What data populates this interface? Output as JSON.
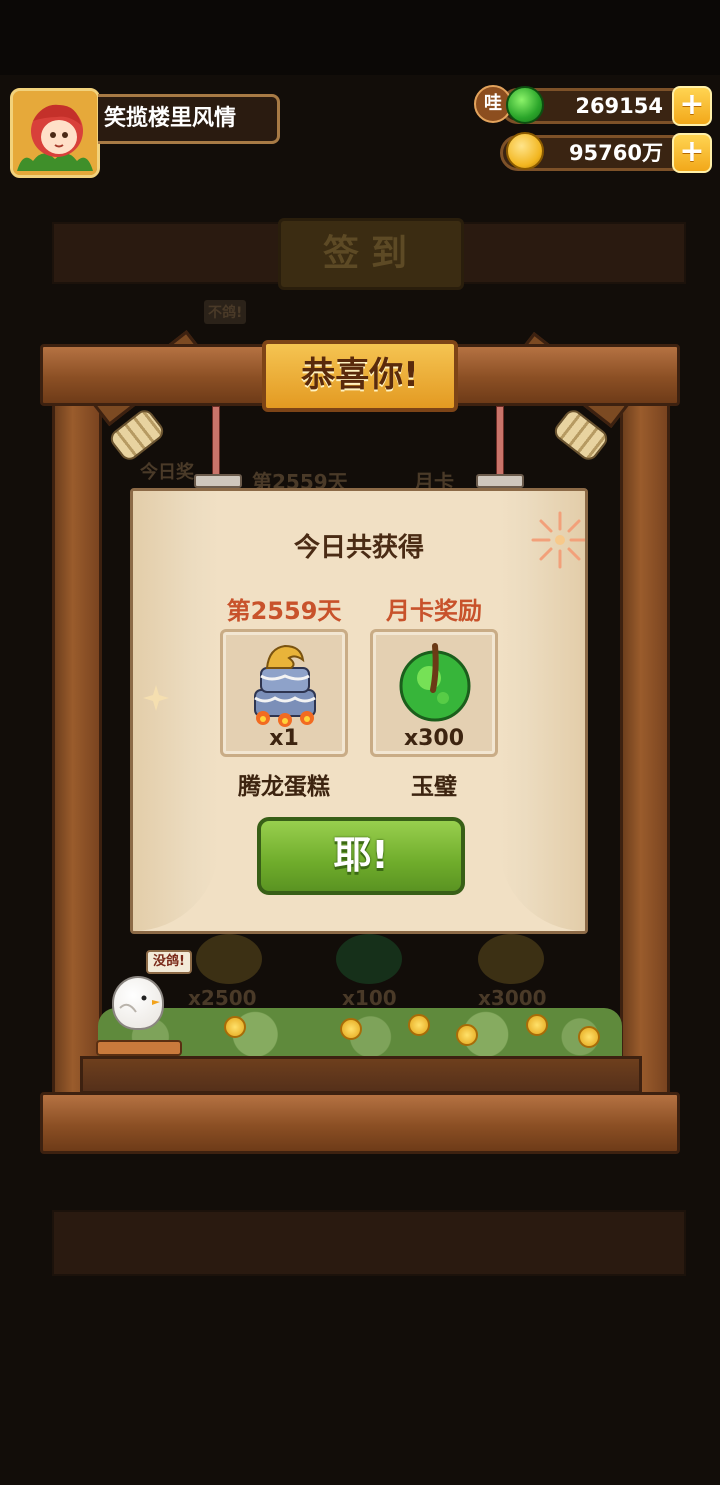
{
  "player": {
    "name": "笑揽楼里风情"
  },
  "currencies": {
    "jade": {
      "badge": "哇",
      "value": "269154",
      "add": "+"
    },
    "gold": {
      "value": "95760万",
      "add": "+"
    }
  },
  "background": {
    "title": "签到",
    "ghost_labels": [
      "不鸽!",
      "今日奖",
      "第2559天",
      "月卡",
      "x2500",
      "x100",
      "x3000"
    ]
  },
  "banner": {
    "title": "恭喜你!"
  },
  "popup": {
    "title": "今日共获得",
    "rewards": [
      {
        "label": "第2559天",
        "quantity": "x1",
        "name": "腾龙蛋糕",
        "icon": "dragon-cake-icon"
      },
      {
        "label": "月卡奖励",
        "quantity": "x300",
        "name": "玉璧",
        "icon": "jade-disc-icon"
      }
    ],
    "confirm_label": "耶!"
  },
  "mascot": {
    "speech": "没鸽!"
  },
  "colors": {
    "wood": "#8b4f24",
    "panel": "#f1e0c4",
    "button_green": "#6fac2b",
    "reward_label": "#c8522b",
    "banner_gold": "#f5c452"
  }
}
